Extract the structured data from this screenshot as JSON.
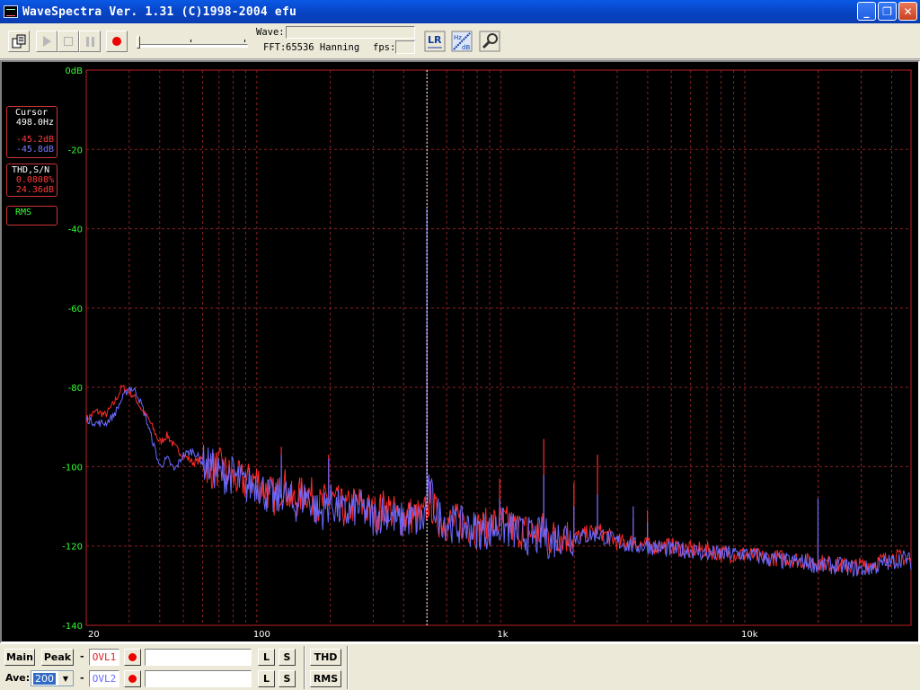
{
  "window": {
    "title": "WaveSpectra  Ver. 1.31  (C)1998-2004 efu",
    "min_symbol": "_",
    "max_symbol": "❐",
    "close_symbol": "✕"
  },
  "toolbar": {
    "wave_label": "Wave:",
    "wave_value": "",
    "fft_label": "FFT:",
    "fft_value": "65536 Hanning",
    "fps_label": "fps:",
    "fps_value": "",
    "slider_level": 0,
    "lr_icon_text": "LR",
    "hz_icon_text_top": "Hz",
    "hz_icon_text_bottom": "dB"
  },
  "info": {
    "cursor_title": "Cursor",
    "cursor_freq": "498.0Hz",
    "cursor_db_left": "-45.2dB",
    "cursor_db_right": "-45.8dB",
    "thd_title": "THD,S/N",
    "thd_value": "0.0808%",
    "sn_value": "24.36dB",
    "rms_title": "RMS"
  },
  "chart_data": {
    "type": "line",
    "x_scale": "log",
    "xlim": [
      20,
      48000
    ],
    "ylim": [
      -140,
      0
    ],
    "y_ticks": [
      0,
      -20,
      -40,
      -60,
      -80,
      -100,
      -120,
      -140
    ],
    "y_tick_labels": [
      "0dB",
      "-20",
      "-40",
      "-60",
      "-80",
      "-100",
      "-120",
      "-140"
    ],
    "x_tick_labels": [
      {
        "value": 20,
        "label": "20"
      },
      {
        "value": 100,
        "label": "100"
      },
      {
        "value": 1000,
        "label": "1k"
      },
      {
        "value": 10000,
        "label": "10k"
      }
    ],
    "cursor_x": 498,
    "grid": true,
    "colors": {
      "grid": "#8a2020",
      "frame": "#c02020",
      "left": "#ff2a2a",
      "right": "#6a6aff",
      "cursor": "#ffffff",
      "ylabel": "#33ff33",
      "xlabel": "#ffffff"
    },
    "series": [
      {
        "channel": "left",
        "points": [
          [
            20,
            -88
          ],
          [
            22,
            -86
          ],
          [
            24,
            -87
          ],
          [
            26,
            -84
          ],
          [
            28,
            -80
          ],
          [
            30,
            -81
          ],
          [
            32,
            -83
          ],
          [
            34,
            -86
          ],
          [
            36,
            -88
          ],
          [
            38,
            -91
          ],
          [
            40,
            -94
          ],
          [
            43,
            -92
          ],
          [
            46,
            -95
          ],
          [
            50,
            -97
          ],
          [
            55,
            -99
          ],
          [
            60,
            -98
          ],
          [
            65,
            -101
          ],
          [
            70,
            -100
          ],
          [
            80,
            -103
          ],
          [
            90,
            -104
          ],
          [
            100,
            -103
          ],
          [
            110,
            -106
          ],
          [
            120,
            -108
          ],
          [
            128,
            -104
          ],
          [
            140,
            -109
          ],
          [
            160,
            -106
          ],
          [
            180,
            -110
          ],
          [
            200,
            -108
          ],
          [
            230,
            -111
          ],
          [
            260,
            -109
          ],
          [
            300,
            -112
          ],
          [
            340,
            -110
          ],
          [
            380,
            -113
          ],
          [
            420,
            -112
          ],
          [
            480,
            -113
          ],
          [
            498,
            -45
          ],
          [
            510,
            -108
          ],
          [
            550,
            -113
          ],
          [
            600,
            -114
          ],
          [
            700,
            -114
          ],
          [
            800,
            -116
          ],
          [
            900,
            -115
          ],
          [
            1000,
            -114
          ],
          [
            1200,
            -116
          ],
          [
            1400,
            -117
          ],
          [
            1500,
            -116
          ],
          [
            1600,
            -118
          ],
          [
            1800,
            -117
          ],
          [
            2000,
            -118
          ],
          [
            2500,
            -116
          ],
          [
            3000,
            -119
          ],
          [
            3500,
            -119
          ],
          [
            4000,
            -120
          ],
          [
            5000,
            -120
          ],
          [
            6000,
            -121
          ],
          [
            7000,
            -121
          ],
          [
            8000,
            -122
          ],
          [
            10000,
            -122
          ],
          [
            12000,
            -123
          ],
          [
            15000,
            -123
          ],
          [
            18000,
            -124
          ],
          [
            20000,
            -124
          ],
          [
            25000,
            -125
          ],
          [
            30000,
            -125
          ],
          [
            35000,
            -124
          ],
          [
            40000,
            -123
          ],
          [
            45000,
            -123
          ],
          [
            48000,
            -124
          ]
        ]
      },
      {
        "channel": "right",
        "points": [
          [
            20,
            -88
          ],
          [
            22,
            -89
          ],
          [
            24,
            -89
          ],
          [
            26,
            -87
          ],
          [
            28,
            -83
          ],
          [
            30,
            -80
          ],
          [
            32,
            -81
          ],
          [
            34,
            -85
          ],
          [
            36,
            -90
          ],
          [
            38,
            -95
          ],
          [
            40,
            -100
          ],
          [
            43,
            -98
          ],
          [
            46,
            -101
          ],
          [
            50,
            -97
          ],
          [
            55,
            -96
          ],
          [
            60,
            -99
          ],
          [
            65,
            -100
          ],
          [
            70,
            -102
          ],
          [
            80,
            -102
          ],
          [
            90,
            -105
          ],
          [
            100,
            -104
          ],
          [
            110,
            -107
          ],
          [
            120,
            -109
          ],
          [
            128,
            -106
          ],
          [
            140,
            -110
          ],
          [
            160,
            -107
          ],
          [
            180,
            -112
          ],
          [
            200,
            -109
          ],
          [
            230,
            -112
          ],
          [
            260,
            -110
          ],
          [
            300,
            -113
          ],
          [
            340,
            -111
          ],
          [
            380,
            -114
          ],
          [
            420,
            -113
          ],
          [
            480,
            -114
          ],
          [
            498,
            -35
          ],
          [
            510,
            -106
          ],
          [
            550,
            -112
          ],
          [
            600,
            -114
          ],
          [
            700,
            -115
          ],
          [
            800,
            -116
          ],
          [
            900,
            -116
          ],
          [
            1000,
            -115
          ],
          [
            1200,
            -117
          ],
          [
            1400,
            -118
          ],
          [
            1500,
            -117
          ],
          [
            1600,
            -119
          ],
          [
            1800,
            -117
          ],
          [
            2000,
            -118
          ],
          [
            2500,
            -117
          ],
          [
            3000,
            -119
          ],
          [
            3500,
            -120
          ],
          [
            4000,
            -120
          ],
          [
            5000,
            -121
          ],
          [
            6000,
            -121
          ],
          [
            7000,
            -122
          ],
          [
            8000,
            -122
          ],
          [
            10000,
            -122
          ],
          [
            12000,
            -123
          ],
          [
            15000,
            -124
          ],
          [
            18000,
            -124
          ],
          [
            20000,
            -125
          ],
          [
            25000,
            -125
          ],
          [
            30000,
            -126
          ],
          [
            35000,
            -125
          ],
          [
            40000,
            -124
          ],
          [
            45000,
            -123
          ],
          [
            48000,
            -124
          ]
        ]
      }
    ],
    "spikes": [
      {
        "x": 498,
        "left": -64,
        "right": -35
      },
      {
        "x": 126,
        "left": -95,
        "right": -97
      },
      {
        "x": 197,
        "left": -97,
        "right": -98
      },
      {
        "x": 990,
        "left": -103,
        "right": -108
      },
      {
        "x": 1500,
        "left": -93,
        "right": -102
      },
      {
        "x": 1994,
        "left": -104,
        "right": -110
      },
      {
        "x": 2490,
        "left": -97,
        "right": -107
      },
      {
        "x": 3490,
        "left": -113,
        "right": -110
      },
      {
        "x": 19950,
        "left": -118,
        "right": -108
      },
      {
        "x": 3990,
        "left": -111,
        "right": -114
      }
    ]
  },
  "bottom": {
    "main_label": "Main",
    "peak_label": "Peak",
    "ave_label": "Ave:",
    "ave_value": "200",
    "dash": "-",
    "ovl1_label": "OVL1",
    "ovl2_label": "OVL2",
    "l_label": "L",
    "s_label": "S",
    "thd_label": "THD",
    "rms_label": "RMS"
  }
}
